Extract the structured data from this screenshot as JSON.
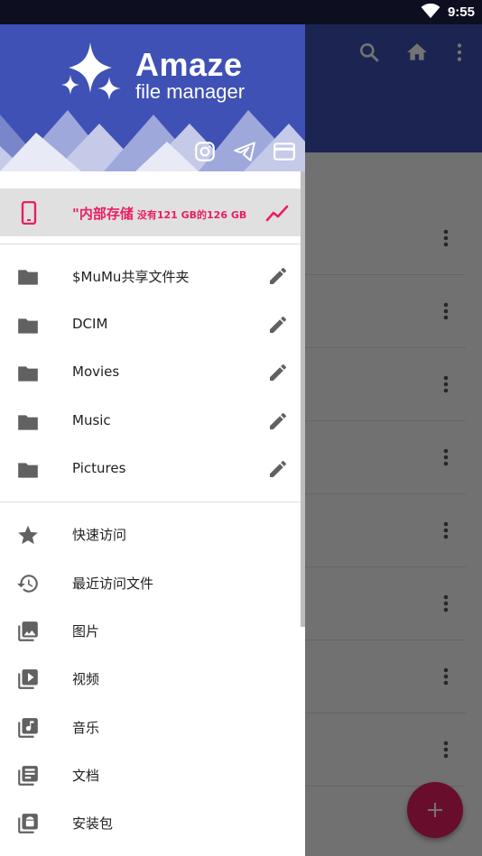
{
  "status_bar": {
    "time": "9:55"
  },
  "drawer": {
    "logo_title": "Amaze",
    "logo_subtitle": "file manager",
    "header_icons": [
      "instagram-icon",
      "telegram-icon",
      "card-icon"
    ],
    "storage": {
      "name": "\"内部存储",
      "detail": "没有121 GB的126 GB"
    },
    "folders": [
      {
        "label": "$MuMu共享文件夹"
      },
      {
        "label": "DCIM"
      },
      {
        "label": "Movies"
      },
      {
        "label": "Music"
      },
      {
        "label": "Pictures"
      }
    ],
    "shortcuts": [
      {
        "label": "快速访问",
        "icon": "star-icon"
      },
      {
        "label": "最近访问文件",
        "icon": "history-icon"
      },
      {
        "label": "图片",
        "icon": "image-library-icon"
      },
      {
        "label": "视频",
        "icon": "video-library-icon"
      },
      {
        "label": "音乐",
        "icon": "music-library-icon"
      },
      {
        "label": "文档",
        "icon": "document-library-icon"
      },
      {
        "label": "安装包",
        "icon": "android-package-icon"
      }
    ]
  },
  "colors": {
    "primary": "#3f51b5",
    "accent": "#e91e63",
    "selected_bg": "#e0e0e0"
  }
}
